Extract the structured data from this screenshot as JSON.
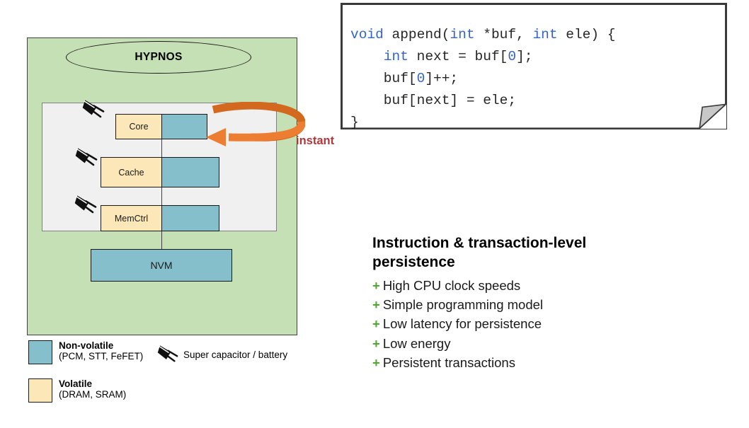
{
  "diagram": {
    "system_label": "HYPNOS",
    "blocks": [
      {
        "name": "core",
        "label": "Core"
      },
      {
        "name": "cache",
        "label": "Cache"
      },
      {
        "name": "memctrl",
        "label": "MemCtrl"
      }
    ],
    "memory_block": {
      "label": "NVM"
    },
    "annotation": {
      "label": "instant",
      "color": "#b0383a"
    },
    "colors": {
      "system_background": "#c5e0b4",
      "chip_background": "#f0f0f0",
      "non_volatile": "#85bfcb",
      "volatile": "#fce7b8",
      "arrow": "#ed7d31"
    }
  },
  "legend": {
    "items": [
      {
        "name": "non-volatile",
        "title": "Non-volatile",
        "subtitle": "(PCM, STT, FeFET)",
        "swatch": "#85bfcb"
      },
      {
        "name": "volatile",
        "title": "Volatile",
        "subtitle": "(DRAM, SRAM)",
        "swatch": "#fce7b8"
      }
    ],
    "capacitor": {
      "icon": "super-capacitor-icon",
      "caption": "Super capacitor / battery"
    }
  },
  "code": {
    "language": "c",
    "lines": [
      [
        {
          "t": "void",
          "c": "kw"
        },
        {
          "t": " append(",
          "c": "plain"
        },
        {
          "t": "int",
          "c": "kw"
        },
        {
          "t": " *buf, ",
          "c": "plain"
        },
        {
          "t": "int",
          "c": "kw"
        },
        {
          "t": " ele) {",
          "c": "plain"
        }
      ],
      [
        {
          "t": "    ",
          "c": "plain"
        },
        {
          "t": "int",
          "c": "kw"
        },
        {
          "t": " next = buf[",
          "c": "plain"
        },
        {
          "t": "0",
          "c": "num"
        },
        {
          "t": "];",
          "c": "plain"
        }
      ],
      [
        {
          "t": "    buf[",
          "c": "plain"
        },
        {
          "t": "0",
          "c": "num"
        },
        {
          "t": "]++;",
          "c": "plain"
        }
      ],
      [
        {
          "t": "    buf[next] = ele;",
          "c": "plain"
        }
      ],
      [
        {
          "t": "}",
          "c": "plain"
        }
      ]
    ],
    "keyword_color": "#3465c4",
    "text_color": "#262626"
  },
  "benefits": {
    "heading": "Instruction & transaction-level persistence",
    "bullet_marker": "+",
    "bullet_color": "#4ea72e",
    "items": [
      "High CPU clock speeds",
      "Simple programming model",
      "Low latency for persistence",
      "Low energy",
      "Persistent transactions"
    ]
  }
}
